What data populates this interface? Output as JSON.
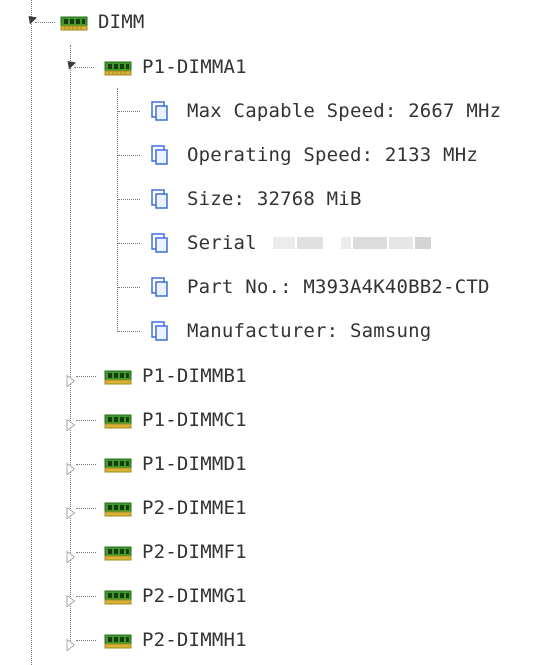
{
  "tree": {
    "root": {
      "label": "DIMM",
      "icon": "dimm-module-icon",
      "expanded": true
    },
    "expanded_module": {
      "label": "P1-DIMMA1",
      "icon": "dimm-module-icon",
      "expanded": true,
      "properties": [
        {
          "label": "Max Capable Speed: 2667 MHz",
          "icon": "property-page-icon"
        },
        {
          "label": "Operating Speed: 2133 MHz",
          "icon": "property-page-icon"
        },
        {
          "label": "Size: 32768 MiB",
          "icon": "property-page-icon"
        },
        {
          "label": "Serial",
          "icon": "property-page-icon",
          "value_redacted": true
        },
        {
          "label": "Part No.: M393A4K40BB2-CTD",
          "icon": "property-page-icon"
        },
        {
          "label": "Manufacturer: Samsung",
          "icon": "property-page-icon"
        }
      ]
    },
    "collapsed_modules": [
      {
        "label": "P1-DIMMB1"
      },
      {
        "label": "P1-DIMMC1"
      },
      {
        "label": "P1-DIMMD1"
      },
      {
        "label": "P2-DIMME1"
      },
      {
        "label": "P2-DIMMF1"
      },
      {
        "label": "P2-DIMMG1"
      },
      {
        "label": "P2-DIMMH1"
      }
    ]
  },
  "colors": {
    "dimm_green": "#3f9a2a",
    "dimm_gold": "#d6b437",
    "page_blue": "#3f6fd6",
    "connector": "#7a7a7a",
    "text": "#333333"
  }
}
